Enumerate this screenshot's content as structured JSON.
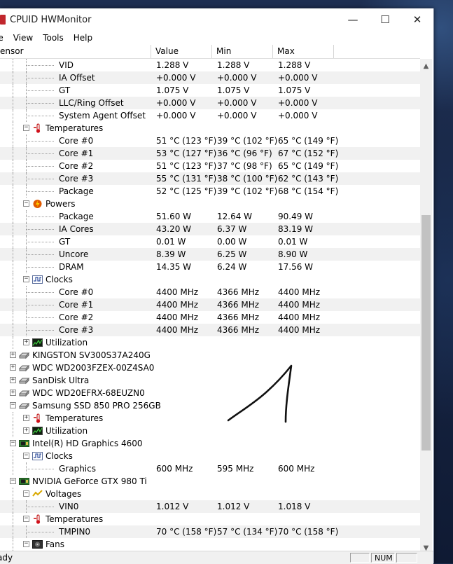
{
  "window": {
    "title": "CPUID HWMonitor",
    "minimize_glyph": "—",
    "maximize_glyph": "☐",
    "close_glyph": "✕"
  },
  "menu": [
    "le",
    "View",
    "Tools",
    "Help"
  ],
  "columns": [
    "ensor",
    "Value",
    "Min",
    "Max"
  ],
  "rows": [
    {
      "label": "VID",
      "value": "1.288 V",
      "min": "1.288 V",
      "max": "1.288 V"
    },
    {
      "label": "IA Offset",
      "value": "+0.000 V",
      "min": "+0.000 V",
      "max": "+0.000 V"
    },
    {
      "label": "GT",
      "value": "1.075 V",
      "min": "1.075 V",
      "max": "1.075 V"
    },
    {
      "label": "LLC/Ring Offset",
      "value": "+0.000 V",
      "min": "+0.000 V",
      "max": "+0.000 V"
    },
    {
      "label": "System Agent Offset",
      "value": "+0.000 V",
      "min": "+0.000 V",
      "max": "+0.000 V"
    },
    {
      "label": "Temperatures",
      "value": "",
      "min": "",
      "max": ""
    },
    {
      "label": "Core #0",
      "value": "51 °C  (123 °F)",
      "min": "39 °C  (102 °F)",
      "max": "65 °C  (149 °F)"
    },
    {
      "label": "Core #1",
      "value": "53 °C  (127 °F)",
      "min": "36 °C  (96 °F)",
      "max": "67 °C  (152 °F)"
    },
    {
      "label": "Core #2",
      "value": "51 °C  (123 °F)",
      "min": "37 °C  (98 °F)",
      "max": "65 °C  (149 °F)"
    },
    {
      "label": "Core #3",
      "value": "55 °C  (131 °F)",
      "min": "38 °C  (100 °F)",
      "max": "62 °C  (143 °F)"
    },
    {
      "label": "Package",
      "value": "52 °C  (125 °F)",
      "min": "39 °C  (102 °F)",
      "max": "68 °C  (154 °F)"
    },
    {
      "label": "Powers",
      "value": "",
      "min": "",
      "max": ""
    },
    {
      "label": "Package",
      "value": "51.60 W",
      "min": "12.64 W",
      "max": "90.49 W"
    },
    {
      "label": "IA Cores",
      "value": "43.20 W",
      "min": "6.37 W",
      "max": "83.19 W"
    },
    {
      "label": "GT",
      "value": "0.01 W",
      "min": "0.00 W",
      "max": "0.01 W"
    },
    {
      "label": "Uncore",
      "value": "8.39 W",
      "min": "6.25 W",
      "max": "8.90 W"
    },
    {
      "label": "DRAM",
      "value": "14.35 W",
      "min": "6.24 W",
      "max": "17.56 W"
    },
    {
      "label": "Clocks",
      "value": "",
      "min": "",
      "max": ""
    },
    {
      "label": "Core #0",
      "value": "4400 MHz",
      "min": "4366 MHz",
      "max": "4400 MHz"
    },
    {
      "label": "Core #1",
      "value": "4400 MHz",
      "min": "4366 MHz",
      "max": "4400 MHz"
    },
    {
      "label": "Core #2",
      "value": "4400 MHz",
      "min": "4366 MHz",
      "max": "4400 MHz"
    },
    {
      "label": "Core #3",
      "value": "4400 MHz",
      "min": "4366 MHz",
      "max": "4400 MHz"
    },
    {
      "label": "Utilization",
      "value": "",
      "min": "",
      "max": ""
    },
    {
      "label": "KINGSTON SV300S37A240G",
      "value": "",
      "min": "",
      "max": ""
    },
    {
      "label": "WDC WD2003FZEX-00Z4SA0",
      "value": "",
      "min": "",
      "max": ""
    },
    {
      "label": "SanDisk Ultra",
      "value": "",
      "min": "",
      "max": ""
    },
    {
      "label": "WDC WD20EFRX-68EUZN0",
      "value": "",
      "min": "",
      "max": ""
    },
    {
      "label": "Samsung SSD 850 PRO 256GB",
      "value": "",
      "min": "",
      "max": ""
    },
    {
      "label": "Temperatures",
      "value": "",
      "min": "",
      "max": ""
    },
    {
      "label": "Utilization",
      "value": "",
      "min": "",
      "max": ""
    },
    {
      "label": "Intel(R) HD Graphics 4600",
      "value": "",
      "min": "",
      "max": ""
    },
    {
      "label": "Clocks",
      "value": "",
      "min": "",
      "max": ""
    },
    {
      "label": "Graphics",
      "value": "600 MHz",
      "min": "595 MHz",
      "max": "600 MHz"
    },
    {
      "label": "NVIDIA GeForce GTX 980 Ti",
      "value": "",
      "min": "",
      "max": ""
    },
    {
      "label": "Voltages",
      "value": "",
      "min": "",
      "max": ""
    },
    {
      "label": "VIN0",
      "value": "1.012 V",
      "min": "1.012 V",
      "max": "1.018 V"
    },
    {
      "label": "Temperatures",
      "value": "",
      "min": "",
      "max": ""
    },
    {
      "label": "TMPIN0",
      "value": "70 °C  (158 °F)",
      "min": "57 °C  (134 °F)",
      "max": "70 °C  (158 °F)"
    },
    {
      "label": "Fans",
      "value": "",
      "min": "",
      "max": ""
    }
  ],
  "status": {
    "text": "ady",
    "num": "NUM"
  },
  "colors": {
    "alt_row": "#f1f1f1",
    "scroll_thumb": "#c2c2c2"
  }
}
